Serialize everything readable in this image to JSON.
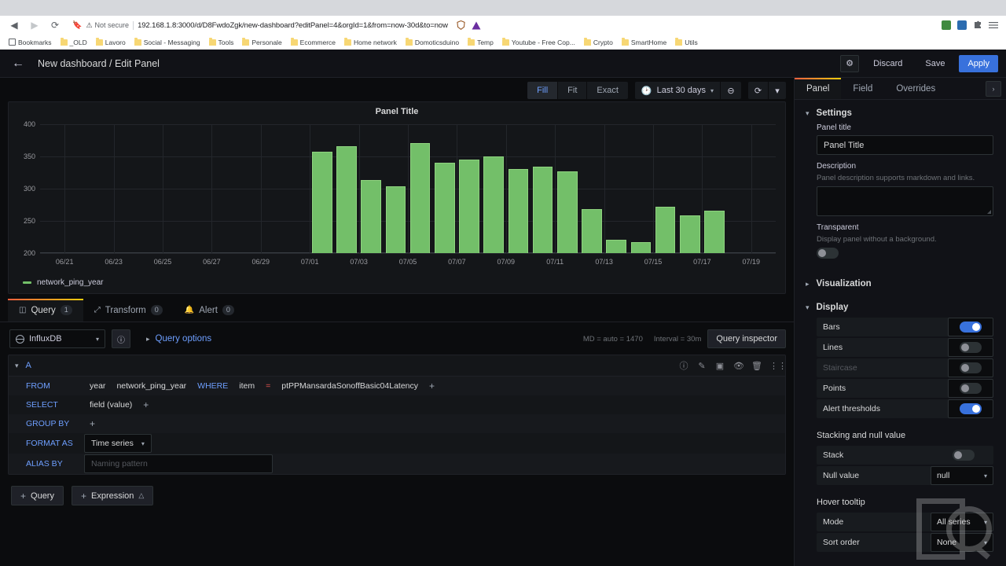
{
  "browser": {
    "back_icon": "back-arrow-icon",
    "forward_icon": "forward-arrow-icon",
    "reload_icon": "reload-icon",
    "bookmark_star_icon": "bookmark-icon",
    "security_label": "Not secure",
    "url": "192.168.1.8:3000/d/D8FwdoZgk/new-dashboard?editPanel=4&orgId=1&from=now-30d&to=now",
    "bookmarks_label": "Bookmarks",
    "bookmarks": [
      "_OLD",
      "Lavoro",
      "Social - Messaging",
      "Tools",
      "Personale",
      "Ecommerce",
      "Home network",
      "Domoticsduino",
      "Temp",
      "Youtube - Free Cop...",
      "Crypto",
      "SmartHome",
      "Utils"
    ]
  },
  "grafana": {
    "header": {
      "back_icon": "back-arrow-icon",
      "breadcrumb": "New dashboard / Edit Panel",
      "settings_icon": "gear-icon",
      "discard_label": "Discard",
      "save_label": "Save",
      "apply_label": "Apply",
      "accent_color": "#3871dc"
    },
    "viz_toolbar": {
      "fill_label": "Fill",
      "fit_label": "Fit",
      "exact_label": "Exact",
      "active_mode": "Fill",
      "clock_icon": "clock-icon",
      "time_range": "Last 30 days",
      "zoom_out_icon": "zoom-out-icon",
      "refresh_icon": "refresh-icon",
      "chevron_icon": "chevron-down-icon"
    },
    "panel": {
      "title": "Panel Title",
      "legend_series": "network_ping_year",
      "series_color": "#73bf69"
    },
    "tabs": [
      {
        "label": "Query",
        "count": "1",
        "icon": "database-icon",
        "active": true
      },
      {
        "label": "Transform",
        "count": "0",
        "icon": "transform-icon",
        "active": false
      },
      {
        "label": "Alert",
        "count": "0",
        "icon": "bell-icon",
        "active": false
      }
    ],
    "datasource": {
      "name": "InfluxDB",
      "icon": "influxdb-icon",
      "help_icon": "help-circle-icon",
      "query_options_label": "Query options",
      "max_data_points": "MD = auto = 1470",
      "interval": "Interval = 30m",
      "query_inspector_label": "Query inspector"
    },
    "query": {
      "ref_id": "A",
      "actions": [
        "info-icon",
        "pencil-icon",
        "duplicate-icon",
        "eye-icon",
        "trash-icon",
        "drag-handle-icon"
      ],
      "from_label": "FROM",
      "from_policy": "year",
      "from_measurement": "network_ping_year",
      "where_label": "WHERE",
      "where_field": "item",
      "where_operator": "=",
      "where_value": "ptPPMansardaSonoffBasic04Latency",
      "add_icon": "plus-icon",
      "select_label": "SELECT",
      "select_field": "field (value)",
      "group_by_label": "GROUP BY",
      "format_as_label": "FORMAT AS",
      "format_as_value": "Time series",
      "alias_by_label": "ALIAS BY",
      "alias_placeholder": "Naming pattern"
    },
    "footer": {
      "add_query_label": "Query",
      "add_expression_label": "Expression",
      "plus_icon": "plus-icon",
      "warning_icon": "warning-triangle-icon"
    },
    "options": {
      "tabs": [
        {
          "label": "Panel",
          "active": true
        },
        {
          "label": "Field",
          "active": false
        },
        {
          "label": "Overrides",
          "active": false
        }
      ],
      "collapse_icon": "chevron-right-icon",
      "settings": {
        "header": "Settings",
        "panel_title_label": "Panel title",
        "panel_title_value": "Panel Title",
        "description_label": "Description",
        "description_hint": "Panel description supports markdown and links.",
        "description_value": "",
        "transparent_label": "Transparent",
        "transparent_hint": "Display panel without a background.",
        "transparent_on": false
      },
      "visualization_header": "Visualization",
      "display": {
        "header": "Display",
        "rows": [
          {
            "label": "Bars",
            "on": true,
            "disabled": false
          },
          {
            "label": "Lines",
            "on": false,
            "disabled": false
          },
          {
            "label": "Staircase",
            "on": false,
            "disabled": true
          },
          {
            "label": "Points",
            "on": false,
            "disabled": false
          },
          {
            "label": "Alert thresholds",
            "on": true,
            "disabled": false
          }
        ]
      },
      "stacking": {
        "header": "Stacking and null value",
        "stack_label": "Stack",
        "stack_on": false,
        "null_value_label": "Null value",
        "null_value": "null"
      },
      "tooltip": {
        "header": "Hover tooltip",
        "mode_label": "Mode",
        "mode_value": "All series",
        "sort_label": "Sort order",
        "sort_value": "None"
      }
    }
  },
  "chart_data": {
    "type": "bar",
    "title": "Panel Title",
    "xlabel": "",
    "ylabel": "",
    "ylim": [
      200,
      400
    ],
    "yticks": [
      200,
      250,
      300,
      350,
      400
    ],
    "xticks": [
      "06/21",
      "06/23",
      "06/25",
      "06/27",
      "06/29",
      "07/01",
      "07/03",
      "07/05",
      "07/07",
      "07/09",
      "07/11",
      "07/13",
      "07/15",
      "07/17",
      "07/19"
    ],
    "grid": true,
    "legend": [
      "network_ping_year"
    ],
    "series": [
      {
        "name": "network_ping_year",
        "color": "#73bf69",
        "x": [
          "07/01",
          "07/02",
          "07/03",
          "07/04",
          "07/05",
          "07/06",
          "07/07",
          "07/08",
          "07/09",
          "07/10",
          "07/11",
          "07/12",
          "07/13",
          "07/14",
          "07/15",
          "07/16",
          "07/17"
        ],
        "values": [
          357,
          366,
          314,
          304,
          371,
          340,
          345,
          350,
          330,
          334,
          327,
          268,
          221,
          217,
          272,
          258,
          266
        ]
      }
    ]
  }
}
